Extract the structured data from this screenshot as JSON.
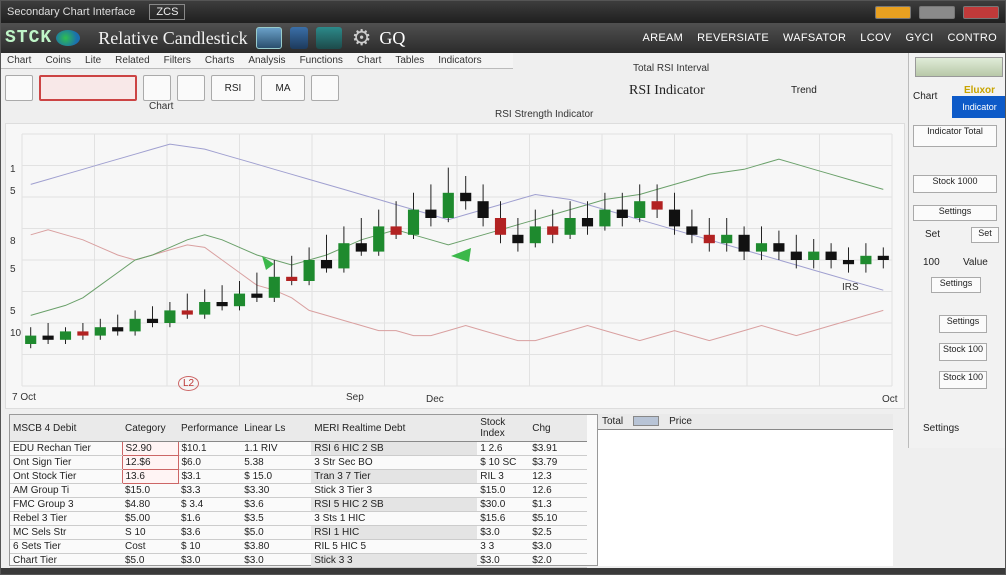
{
  "window": {
    "title": "Secondary Chart Interface",
    "tab": "ZCS",
    "buttons": [
      "minimize",
      "maximize",
      "close"
    ]
  },
  "toolbar": {
    "logo": "STCK",
    "app_title": "Relative Candlestick",
    "q_label": "GQ",
    "menu": [
      "AREAM",
      "REVERSIATE",
      "WAFSATOR",
      "LCOV",
      "GYCI",
      "CONTRO"
    ]
  },
  "submenu": [
    "Chart",
    "Coins",
    "Lite",
    "Related",
    "Filters",
    "Charts",
    "Analysis",
    "Functions",
    "Chart",
    "Tables",
    "Indicators"
  ],
  "subtools": {
    "label": "Chart",
    "btn1": "RSI",
    "btn2": "MA"
  },
  "indicator": {
    "title": "RSI Indicator",
    "subtitle": "Total RSI Interval",
    "side": "Trend"
  },
  "chart": {
    "title": "RSI Strength Indicator",
    "y_labels": [
      "1",
      "5",
      "8",
      "5",
      "10",
      "5"
    ],
    "x_labels": [
      "7 Oct",
      "Sep",
      "Dec",
      "Oct"
    ],
    "badge": "L2",
    "label_right": "IRS"
  },
  "chart_data": {
    "type": "candlestick",
    "title": "RSI Strength Indicator",
    "candles": [
      [
        10,
        12,
        14,
        9
      ],
      [
        12,
        11,
        15,
        10
      ],
      [
        11,
        13,
        14,
        10
      ],
      [
        13,
        12,
        15,
        11
      ],
      [
        12,
        14,
        16,
        11
      ],
      [
        14,
        13,
        17,
        12
      ],
      [
        13,
        16,
        18,
        12
      ],
      [
        16,
        15,
        19,
        14
      ],
      [
        15,
        18,
        20,
        14
      ],
      [
        18,
        17,
        22,
        16
      ],
      [
        17,
        20,
        23,
        16
      ],
      [
        20,
        19,
        24,
        18
      ],
      [
        19,
        22,
        25,
        18
      ],
      [
        22,
        21,
        27,
        20
      ],
      [
        21,
        26,
        30,
        20
      ],
      [
        26,
        25,
        31,
        24
      ],
      [
        25,
        30,
        33,
        24
      ],
      [
        30,
        28,
        36,
        27
      ],
      [
        28,
        34,
        38,
        27
      ],
      [
        34,
        32,
        40,
        31
      ],
      [
        32,
        38,
        42,
        31
      ],
      [
        38,
        36,
        44,
        35
      ],
      [
        36,
        42,
        46,
        35
      ],
      [
        42,
        40,
        48,
        38
      ],
      [
        40,
        46,
        52,
        39
      ],
      [
        46,
        44,
        50,
        42
      ],
      [
        44,
        40,
        48,
        38
      ],
      [
        40,
        36,
        44,
        34
      ],
      [
        36,
        34,
        40,
        32
      ],
      [
        34,
        38,
        42,
        33
      ],
      [
        38,
        36,
        42,
        34
      ],
      [
        36,
        40,
        44,
        35
      ],
      [
        40,
        38,
        44,
        36
      ],
      [
        38,
        42,
        46,
        37
      ],
      [
        42,
        40,
        46,
        38
      ],
      [
        40,
        44,
        48,
        39
      ],
      [
        44,
        42,
        48,
        40
      ],
      [
        42,
        38,
        46,
        36
      ],
      [
        38,
        36,
        42,
        34
      ],
      [
        36,
        34,
        40,
        32
      ],
      [
        34,
        36,
        40,
        32
      ],
      [
        36,
        32,
        38,
        30
      ],
      [
        32,
        34,
        38,
        30
      ],
      [
        34,
        32,
        37,
        30
      ],
      [
        32,
        30,
        36,
        28
      ],
      [
        30,
        32,
        35,
        28
      ],
      [
        32,
        30,
        34,
        28
      ],
      [
        30,
        29,
        33,
        27
      ],
      [
        29,
        31,
        34,
        27
      ],
      [
        31,
        30,
        33,
        28
      ]
    ],
    "line1": [
      60,
      62,
      60,
      58,
      55,
      52,
      50,
      52,
      54,
      56,
      55,
      50,
      45,
      40,
      38,
      35,
      30,
      28,
      26,
      24,
      22,
      22,
      20,
      20,
      22,
      24,
      22,
      20,
      18,
      18,
      20,
      22,
      24,
      22,
      20,
      18,
      20,
      22,
      20,
      18,
      20,
      22,
      24,
      22,
      20,
      22,
      24,
      26,
      28,
      30
    ],
    "line2": [
      28,
      30,
      32,
      35,
      40,
      45,
      50,
      52,
      55,
      58,
      60,
      58,
      55,
      52,
      50,
      48,
      50,
      52,
      55,
      58,
      60,
      62,
      60,
      58,
      56,
      58,
      60,
      62,
      64,
      66,
      68,
      70,
      72,
      74,
      75,
      76,
      78,
      80,
      82,
      84,
      85,
      86,
      88,
      90,
      88,
      86,
      84,
      82,
      80,
      78
    ],
    "line3": [
      80,
      82,
      84,
      86,
      88,
      90,
      92,
      94,
      96,
      95,
      94,
      92,
      90,
      88,
      86,
      84,
      82,
      80,
      78,
      76,
      74,
      72,
      70,
      68,
      66,
      68,
      70,
      72,
      74,
      76,
      75,
      74,
      72,
      70,
      68,
      66,
      64,
      62,
      60,
      58,
      56,
      54,
      52,
      50,
      48,
      46,
      44,
      42,
      40,
      38
    ]
  },
  "right_panel": {
    "top_label": "Chart",
    "badge_top": "Eluxor",
    "badge": "Indicator",
    "btn1": "Indicator Total",
    "btn2": "Stock 1000",
    "btn3": "Settings",
    "lbl1": "Set",
    "btn4": "Set",
    "lbl2": "100",
    "lbl3": "Value",
    "btn5": "Settings",
    "btn6": "Settings",
    "btn7": "Stock 100",
    "btn8": "Stock 100",
    "lbl4": "Settings"
  },
  "table": {
    "headers": [
      "MSCB 4 Debit",
      "Category",
      "Performance",
      "Linear Ls",
      "MERI Realtime Debt",
      "Stock Index",
      "Chg"
    ],
    "rows": [
      [
        "EDU Rechan Tier",
        "S2.90",
        "$10.1",
        "1.1 RIV",
        "RSI 6 HIC 2 SB",
        "1 2.6",
        "$3.91"
      ],
      [
        "Ont Sign Tier",
        "12.$6",
        "$6.0",
        "5.38",
        "3 Str Sec BO",
        "$ 10 SC",
        "$3.79"
      ],
      [
        "Ont Stock Tier",
        "13.6",
        "$3.1",
        "$ 15.0",
        "Tran 3 7 Tier",
        "RIL 3",
        "12.3"
      ],
      [
        "AM Group Ti",
        "$15.0",
        "$3.3",
        "$3.30",
        "Stick 3 Tier 3",
        "$15.0",
        "12.6"
      ],
      [
        "FMC Group 3",
        "$4.80",
        "$ 3.4",
        "$3.6",
        "RSI 5 HIC 2 SB",
        "$30.0",
        "$1.3"
      ],
      [
        "Rebel 3 Tier",
        "$5.00",
        "$1.6",
        "$3.5",
        "3 Sts 1 HIC",
        "$15.6",
        "$5.10"
      ],
      [
        "MC Sels Str",
        "S 10",
        "$3.6",
        "$5.0",
        "RSI 1 HIC",
        "$3.0",
        "$2.5"
      ],
      [
        "6 Sets Tier",
        "Cost",
        "$ 10",
        "$3.80",
        "RIL 5 HIC 5",
        "3 3",
        "$3.0"
      ],
      [
        "Chart Tier",
        "$5.0",
        "$3.0",
        "$3.0",
        "Stick 3 3",
        "$3.0",
        "$2.0"
      ]
    ]
  },
  "side_table": {
    "h1": "Total",
    "h2": "Price"
  }
}
